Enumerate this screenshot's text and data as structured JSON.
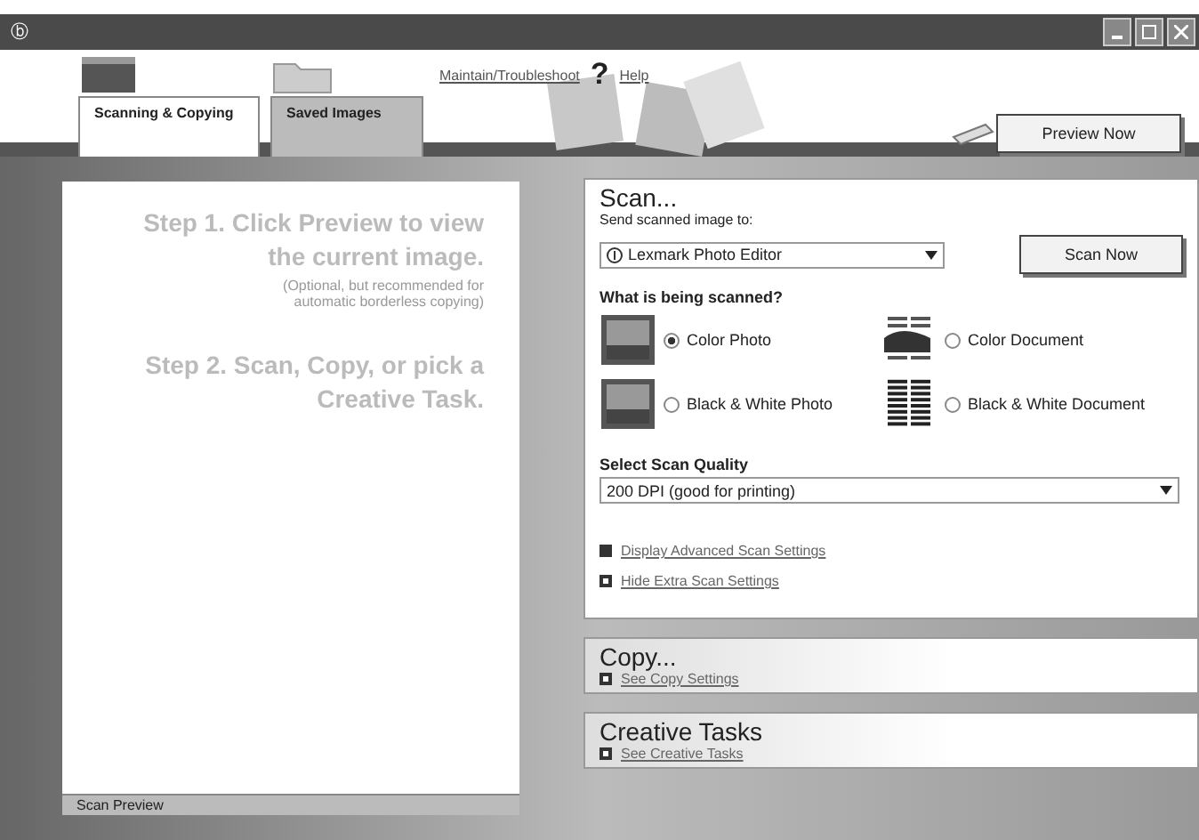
{
  "window": {
    "title_icon": "ⓑ"
  },
  "header": {
    "links": [
      "Maintain/Troubleshoot",
      "Help"
    ],
    "help_mark": "?",
    "preview_button": "Preview Now"
  },
  "tabs": [
    {
      "label": "Scanning & Copying",
      "selected": true
    },
    {
      "label": "Saved Images",
      "selected": false
    }
  ],
  "preview": {
    "step1": "Step 1.  Click Preview to view the current image.",
    "note": "(Optional, but recommended for automatic borderless copying)",
    "step2": "Step 2.  Scan, Copy, or pick a Creative Task.",
    "footer": "Scan Preview"
  },
  "scan": {
    "title": "Scan...",
    "send_label": "Send scanned image to:",
    "destination": "Lexmark Photo Editor",
    "scan_button": "Scan Now",
    "question": "What is being scanned?",
    "options": [
      {
        "label": "Color Photo",
        "kind": "photo",
        "selected": true
      },
      {
        "label": "Color Document",
        "kind": "color-document",
        "selected": false
      },
      {
        "label": "Black & White Photo",
        "kind": "photo",
        "selected": false
      },
      {
        "label": "Black & White Document",
        "kind": "document",
        "selected": false
      }
    ],
    "quality_label": "Select Scan Quality",
    "quality": "200 DPI (good for printing)",
    "links": [
      {
        "label": "Display Advanced Scan Settings",
        "expanded": false
      },
      {
        "label": "Hide Extra Scan Settings",
        "expanded": true
      }
    ]
  },
  "copy": {
    "title": "Copy...",
    "link": "See Copy Settings"
  },
  "creative": {
    "title": "Creative Tasks",
    "link": "See Creative Tasks"
  }
}
